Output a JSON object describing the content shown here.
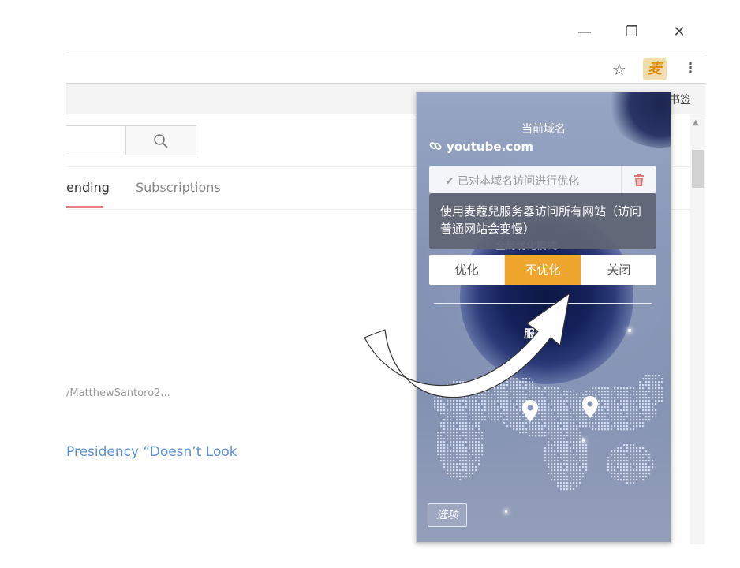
{
  "window": {
    "minimize": "—",
    "restore": "❐",
    "close": "✕"
  },
  "toolbar": {
    "bookmark_star": "☆",
    "extension_icon_glyph": "麦",
    "menu": "⋮",
    "bookmarks_label": "书签"
  },
  "youtube": {
    "tabs": [
      {
        "label": "ending"
      },
      {
        "label": "Subscriptions"
      }
    ],
    "video_url": "/MatthewSantoro2...",
    "video_title": "Presidency “Doesn’t Look"
  },
  "popup": {
    "current_domain_title": "当前域名",
    "domain": "youtube.com",
    "optimization_status": "✔ 已对本域名访问进行优化",
    "mode_label": "全局优化模式",
    "tooltip": "使用麦蔻兒服务器访问所有网站（访问普通网站会变慢）",
    "modes": [
      {
        "label": "优化",
        "active": false
      },
      {
        "label": "不优化",
        "active": true
      },
      {
        "label": "关闭",
        "active": false
      }
    ],
    "server_label": "服务器",
    "options_button": "选项"
  },
  "colors": {
    "accent": "#f0a52c",
    "popup_bg": "#8a98b8",
    "link": "#5b8fd6",
    "tab_underline": "#cc181e"
  },
  "icons": [
    "search-icon",
    "link-icon",
    "trash-icon",
    "location-pin-icon",
    "star-icon",
    "menu-dots-icon"
  ]
}
